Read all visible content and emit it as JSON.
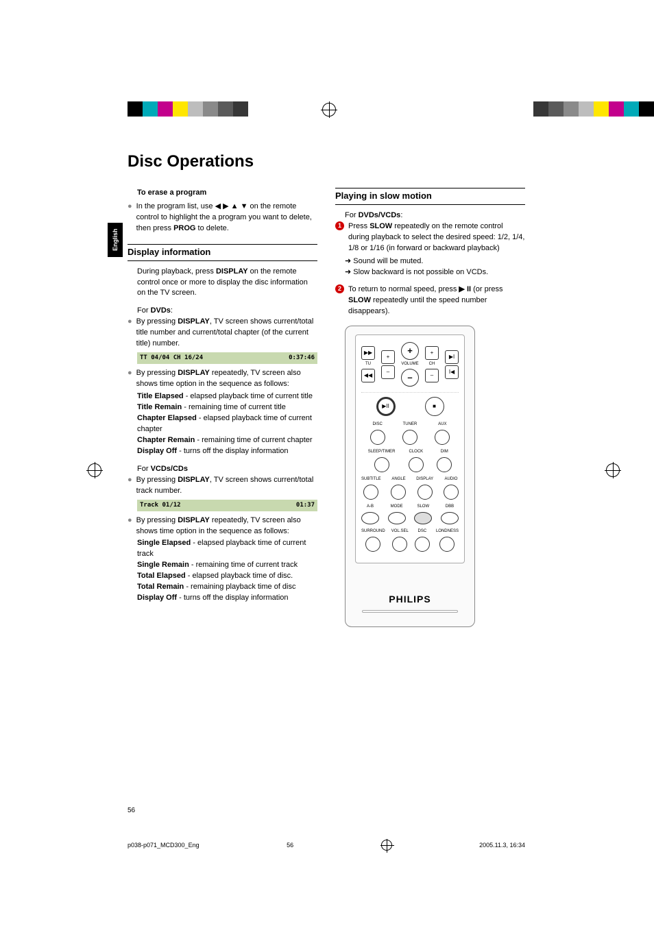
{
  "heading": "Disc Operations",
  "english_tab": "English",
  "left": {
    "erase_title": "To erase a program",
    "erase_body": "In the program list, use ◀ ▶ ▲ ▼ on the remote control to highlight the a program you want to delete, then press PROG to delete.",
    "disp_heading": "Display information",
    "disp_intro": "During playback, press DISPLAY on the remote control once or more to display the disc information on the TV screen.",
    "for_dvds": "For DVDs:",
    "dvds_b1": "By pressing DISPLAY,  TV screen shows current/total title number and current/total chapter (of the current title) number.",
    "dvds_bar_left": "TT   04/04   CH   16/24",
    "dvds_bar_right": "0:37:46",
    "dvds_b2": "By pressing DISPLAY repeatedly, TV screen also shows time option in the sequence as follows:",
    "title_elapsed_l": "Title Elapsed",
    "title_elapsed_r": " - elapsed playback time of current title",
    "title_remain_l": "Title Remain",
    "title_remain_r": " - remaining time of current title",
    "chap_elapsed_l": "Chapter Elapsed",
    "chap_elapsed_r": " - elapsed playback time of current chapter",
    "chap_remain_l": "Chapter Remain",
    "chap_remain_r": " - remaining time of current chapter",
    "disp_off_l": "Display Off",
    "disp_off_r": " - turns off the display information",
    "for_vcds": "For VCDs/CDs",
    "vcds_b1": "By pressing DISPLAY, TV screen shows current/total track number.",
    "vcds_bar_left": "Track 01/12",
    "vcds_bar_right": "01:37",
    "vcds_b2": "By pressing DISPLAY repeatedly, TV screen also shows time option in the sequence as follows:",
    "single_elapsed_l": "Single Elapsed",
    "single_elapsed_r": " - elapsed playback time of current track",
    "single_remain_l": "Single Remain",
    "single_remain_r": " - remaining time of current track",
    "total_elapsed_l": "Total Elapsed",
    "total_elapsed_r": " - elapsed playback time of disc.",
    "total_remain_l": "Total Remain",
    "total_remain_r": " - remaining playback time of disc",
    "disp_off2_l": "Display Off",
    "disp_off2_r": " - turns off the display information"
  },
  "right": {
    "slow_heading": "Playing in slow motion",
    "for_dvds_vcds": "For DVDs/VCDs:",
    "step1": "Press SLOW repeatedly on the remote control during playback to select the desired speed: 1/2, 1/4, 1/8 or 1/16 (in forward or backward playback)",
    "arr1": "➜ Sound will be muted.",
    "arr2": "➜ Slow backward is not possible on VCDs.",
    "step2": "To return to normal speed, press ▶ II (or press SLOW repeatedly until the speed number disappears)."
  },
  "remote": {
    "tu": "TU",
    "volume": "VOLUME",
    "ch": "CH",
    "ffwd": "▶▶",
    "rew": "◀◀",
    "next": "▶I",
    "prev": "I◀",
    "plus": "+",
    "minus": "–",
    "playpause": "▶II",
    "stop": "■",
    "row1": [
      "DISC",
      "TUNER",
      "AUX"
    ],
    "row2": [
      "SLEEP/TIMER",
      "CLOCK",
      "DIM"
    ],
    "row3": [
      "SUBTITLE",
      "ANGLE",
      "DISPLAY",
      "AUDIO"
    ],
    "row4": [
      "A-B",
      "MODE",
      "SLOW",
      "DBB"
    ],
    "row5": [
      "SURROUND",
      "VOL.SEL",
      "DSC",
      "LONDNESS"
    ],
    "brand": "PHILIPS"
  },
  "page_num": "56",
  "footer": {
    "file": "p038-p071_MCD300_Eng",
    "page": "56",
    "datetime": "2005.11.3, 16:34"
  }
}
